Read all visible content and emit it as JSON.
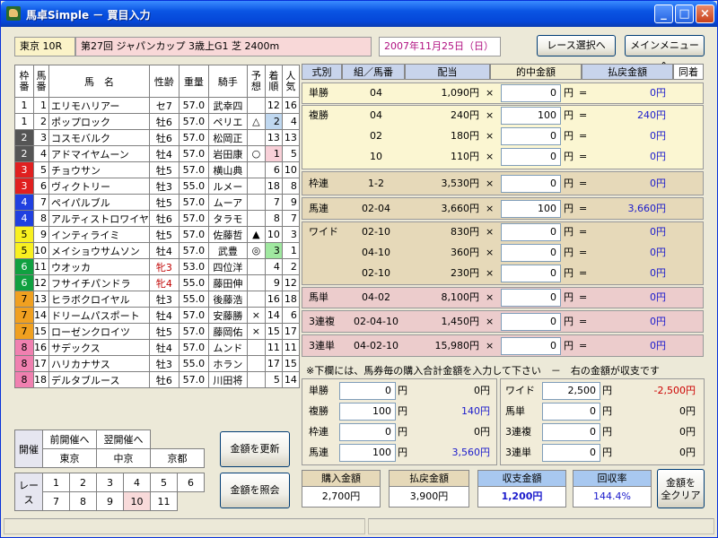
{
  "window": {
    "title": "馬卓Simple － 買目入力",
    "min": "_",
    "max": "□",
    "close": "×"
  },
  "race": {
    "venue_race": "東京 10R",
    "name": "第27回 ジャパンカップ 3歳上G1 芝 2400m",
    "date": "2007年11月25日（日）"
  },
  "buttons": {
    "race_select": "レース選択へ",
    "main_menu": "メインメニューへ",
    "update": "金額を更新",
    "inquire": "金額を照会",
    "clear_all_1": "金額を",
    "clear_all_2": "全クリア"
  },
  "horses_header": {
    "waku": "枠\n番",
    "uma": "馬\n番",
    "name": "馬　名",
    "sexage": "性齢",
    "weight": "重量",
    "jockey": "騎手",
    "yoso": "予\n想",
    "chaku": "着\n順",
    "ninki": "人\n気"
  },
  "horses": [
    {
      "waku": "1",
      "uma": "1",
      "name": "エリモハリアー",
      "sexage": "セ7",
      "weight": "57.0",
      "jockey": "武幸四",
      "yoso": "",
      "chaku": "12",
      "ninki": "16"
    },
    {
      "waku": "1",
      "uma": "2",
      "name": "ポップロック",
      "sexage": "牡6",
      "weight": "57.0",
      "jockey": "ペリエ",
      "yoso": "△",
      "chaku": "2",
      "ninki": "4"
    },
    {
      "waku": "2",
      "uma": "3",
      "name": "コスモバルク",
      "sexage": "牡6",
      "weight": "57.0",
      "jockey": "松岡正",
      "yoso": "",
      "chaku": "13",
      "ninki": "13"
    },
    {
      "waku": "2",
      "uma": "4",
      "name": "アドマイヤムーン",
      "sexage": "牡4",
      "weight": "57.0",
      "jockey": "岩田康",
      "yoso": "○",
      "chaku": "1",
      "ninki": "5"
    },
    {
      "waku": "3",
      "uma": "5",
      "name": "チョウサン",
      "sexage": "牡5",
      "weight": "57.0",
      "jockey": "横山典",
      "yoso": "",
      "chaku": "6",
      "ninki": "10"
    },
    {
      "waku": "3",
      "uma": "6",
      "name": "ヴィクトリー",
      "sexage": "牡3",
      "weight": "55.0",
      "jockey": "ルメー",
      "yoso": "",
      "chaku": "18",
      "ninki": "8"
    },
    {
      "waku": "4",
      "uma": "7",
      "name": "ペイパルブル",
      "sexage": "牡5",
      "weight": "57.0",
      "jockey": "ムーア",
      "yoso": "",
      "chaku": "7",
      "ninki": "9"
    },
    {
      "waku": "4",
      "uma": "8",
      "name": "アルティストロワイヤ",
      "sexage": "牡6",
      "weight": "57.0",
      "jockey": "タラモ",
      "yoso": "",
      "chaku": "8",
      "ninki": "7"
    },
    {
      "waku": "5",
      "uma": "9",
      "name": "インティライミ",
      "sexage": "牡5",
      "weight": "57.0",
      "jockey": "佐藤哲",
      "yoso": "▲",
      "chaku": "10",
      "ninki": "3"
    },
    {
      "waku": "5",
      "uma": "10",
      "name": "メイショウサムソン",
      "sexage": "牡4",
      "weight": "57.0",
      "jockey": "武豊",
      "yoso": "◎",
      "chaku": "3",
      "ninki": "1"
    },
    {
      "waku": "6",
      "uma": "11",
      "name": "ウオッカ",
      "sexage": "牝3",
      "weight": "53.0",
      "jockey": "四位洋",
      "yoso": "",
      "chaku": "4",
      "ninki": "2"
    },
    {
      "waku": "6",
      "uma": "12",
      "name": "フサイチパンドラ",
      "sexage": "牝4",
      "weight": "55.0",
      "jockey": "藤田伸",
      "yoso": "",
      "chaku": "9",
      "ninki": "12"
    },
    {
      "waku": "7",
      "uma": "13",
      "name": "ヒラボクロイヤル",
      "sexage": "牡3",
      "weight": "55.0",
      "jockey": "後藤浩",
      "yoso": "",
      "chaku": "16",
      "ninki": "18"
    },
    {
      "waku": "7",
      "uma": "14",
      "name": "ドリームパスポート",
      "sexage": "牡4",
      "weight": "57.0",
      "jockey": "安藤勝",
      "yoso": "×",
      "chaku": "14",
      "ninki": "6"
    },
    {
      "waku": "7",
      "uma": "15",
      "name": "ローゼンクロイツ",
      "sexage": "牡5",
      "weight": "57.0",
      "jockey": "藤岡佑",
      "yoso": "×",
      "chaku": "15",
      "ninki": "17"
    },
    {
      "waku": "8",
      "uma": "16",
      "name": "サデックス",
      "sexage": "牡4",
      "weight": "57.0",
      "jockey": "ムンド",
      "yoso": "",
      "chaku": "11",
      "ninki": "11"
    },
    {
      "waku": "8",
      "uma": "17",
      "name": "ハリカナサス",
      "sexage": "牡3",
      "weight": "55.0",
      "jockey": "ホラン",
      "yoso": "",
      "chaku": "17",
      "ninki": "15"
    },
    {
      "waku": "8",
      "uma": "18",
      "name": "デルタブルース",
      "sexage": "牡6",
      "weight": "57.0",
      "jockey": "川田将",
      "yoso": "",
      "chaku": "5",
      "ninki": "14"
    }
  ],
  "nav": {
    "kaisai": "開催",
    "prev": "前開催へ",
    "next": "翌開催へ",
    "venues": [
      "東京",
      "中京",
      "京都"
    ],
    "race_label": "レース",
    "races": [
      "1",
      "2",
      "3",
      "4",
      "5",
      "6",
      "7",
      "8",
      "9",
      "10",
      "11"
    ]
  },
  "bet_header": {
    "type": "式別",
    "combo": "組／馬番",
    "payout": "配当",
    "hit_amount": "的中金額",
    "refund": "払戻金額",
    "dohan": "同着"
  },
  "bets": [
    {
      "type": "単勝",
      "combo": "04",
      "payout": "1,090円",
      "amount": "0",
      "refund": "0円"
    },
    {
      "type": "複勝",
      "combo": "04",
      "payout": "240円",
      "amount": "100",
      "refund": "240円"
    },
    {
      "type": "",
      "combo": "02",
      "payout": "180円",
      "amount": "0",
      "refund": "0円"
    },
    {
      "type": "",
      "combo": "10",
      "payout": "110円",
      "amount": "0",
      "refund": "0円"
    },
    {
      "type": "枠連",
      "combo": "1-2",
      "payout": "3,530円",
      "amount": "0",
      "refund": "0円"
    },
    {
      "type": "馬連",
      "combo": "02-04",
      "payout": "3,660円",
      "amount": "100",
      "refund": "3,660円"
    },
    {
      "type": "ワイド",
      "combo": "02-10",
      "payout": "830円",
      "amount": "0",
      "refund": "0円"
    },
    {
      "type": "",
      "combo": "04-10",
      "payout": "360円",
      "amount": "0",
      "refund": "0円"
    },
    {
      "type": "",
      "combo": "02-10",
      "payout": "230円",
      "amount": "0",
      "refund": "0円"
    },
    {
      "type": "馬単",
      "combo": "04-02",
      "payout": "8,100円",
      "amount": "0",
      "refund": "0円"
    },
    {
      "type": "3連複",
      "combo": "02-04-10",
      "payout": "1,450円",
      "amount": "0",
      "refund": "0円"
    },
    {
      "type": "3連単",
      "combo": "04-02-10",
      "payout": "15,980円",
      "amount": "0",
      "refund": "0円"
    }
  ],
  "symbols": {
    "x": "×",
    "yen": "円",
    "eq": "="
  },
  "note": "※下欄には、馬券毎の購入合計金額を入力して下さい　－　右の金額が収支です",
  "purchase_left": [
    {
      "type": "単勝",
      "amount": "0",
      "result": "0円",
      "color": "#000000"
    },
    {
      "type": "複勝",
      "amount": "100",
      "result": "140円",
      "color": "#1a1acc"
    },
    {
      "type": "枠連",
      "amount": "0",
      "result": "0円",
      "color": "#000000"
    },
    {
      "type": "馬連",
      "amount": "100",
      "result": "3,560円",
      "color": "#1a1acc"
    }
  ],
  "purchase_right": [
    {
      "type": "ワイド",
      "amount": "2,500",
      "result": "-2,500円",
      "color": "#cc0000"
    },
    {
      "type": "馬単",
      "amount": "0",
      "result": "0円",
      "color": "#000000"
    },
    {
      "type": "3連複",
      "amount": "0",
      "result": "0円",
      "color": "#000000"
    },
    {
      "type": "3連単",
      "amount": "0",
      "result": "0円",
      "color": "#000000"
    }
  ],
  "summary": {
    "buy_label": "購入金額",
    "buy": "2,700円",
    "refund_label": "払戻金額",
    "refund": "3,900円",
    "balance_label": "収支金額",
    "balance": "1,200円",
    "rate_label": "回収率",
    "rate": "144.4%"
  },
  "colors": {
    "waku1": "#ffffff",
    "waku2": "#555555",
    "waku3": "#e02020",
    "waku4": "#2040e0",
    "waku5": "#f8f020",
    "waku6": "#10a040",
    "waku7": "#f0a020",
    "waku8": "#f080b0",
    "bet_yellow": "#fbf6d2",
    "bet_tan": "#e6d9b9",
    "bet_pink": "#eccccc"
  }
}
